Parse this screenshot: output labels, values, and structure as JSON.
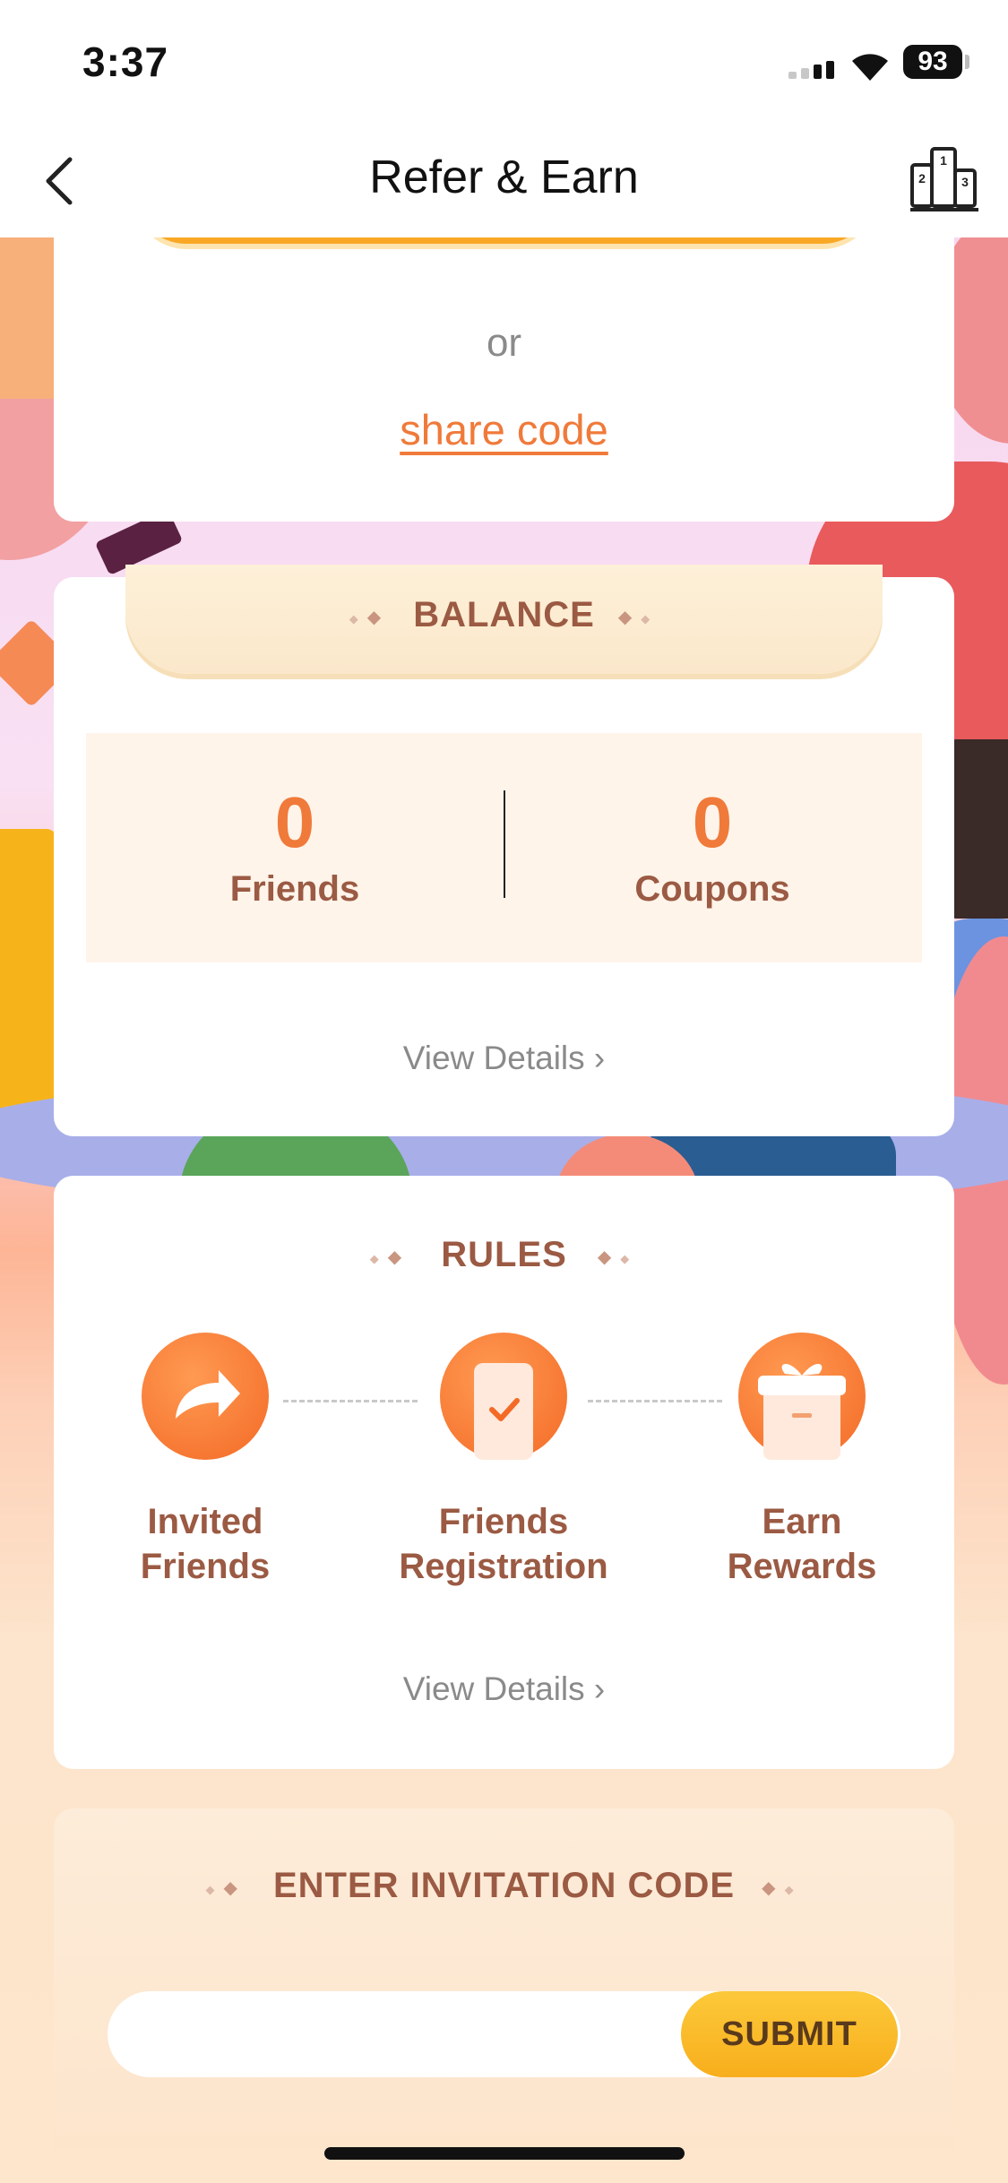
{
  "status_bar": {
    "time": "3:37",
    "battery": "93"
  },
  "nav": {
    "title": "Refer & Earn"
  },
  "share": {
    "or_text": "or",
    "share_code_label": "share code"
  },
  "balance": {
    "heading": "BALANCE",
    "friends_count": "0",
    "friends_label": "Friends",
    "coupons_count": "0",
    "coupons_label": "Coupons",
    "view_details": "View Details ›"
  },
  "rules": {
    "heading": "RULES",
    "steps": [
      {
        "label_line1": "Invited",
        "label_line2": "Friends",
        "icon": "share-arrow-icon"
      },
      {
        "label_line1": "Friends",
        "label_line2": "Registration",
        "icon": "phone-check-icon"
      },
      {
        "label_line1": "Earn",
        "label_line2": "Rewards",
        "icon": "gift-icon"
      }
    ],
    "view_details": "View Details ›"
  },
  "invite": {
    "heading": "ENTER INVITATION CODE",
    "input_placeholder": "",
    "submit_label": "SUBMIT"
  },
  "colors": {
    "accent_orange": "#f07a3a",
    "heading_brown": "#9b5a43",
    "submit_yellow": "#f8ae1c",
    "share_button_yellow": "#f9a825"
  }
}
